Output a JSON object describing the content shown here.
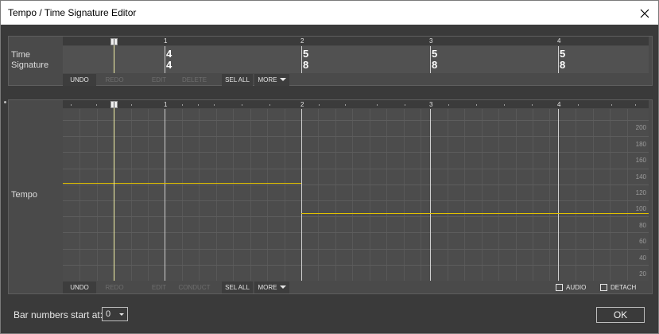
{
  "window": {
    "title": "Tempo / Time Signature Editor",
    "close_icon": "close-icon"
  },
  "time_signature_panel": {
    "label_line1": "Time",
    "label_line2": "Signature",
    "bar_numbers": [
      "1",
      "2",
      "3",
      "4"
    ],
    "signatures": [
      {
        "bar": "1",
        "numerator": "4",
        "denominator": "4"
      },
      {
        "bar": "2",
        "numerator": "5",
        "denominator": "8"
      },
      {
        "bar": "3",
        "numerator": "5",
        "denominator": "8"
      },
      {
        "bar": "4",
        "numerator": "5",
        "denominator": "8"
      }
    ],
    "toolbar": {
      "undo": "UNDO",
      "redo": "REDO",
      "edit": "EDIT",
      "delete": "DELETE",
      "sel_all": "SEL ALL",
      "more": "MORE"
    }
  },
  "tempo_panel": {
    "label": "Tempo",
    "bar_numbers": [
      "1",
      "2",
      "3",
      "4"
    ],
    "y_axis_labels": [
      "200",
      "180",
      "160",
      "140",
      "120",
      "100",
      "80",
      "60",
      "40",
      "20"
    ],
    "tempo_segments": [
      {
        "from_bar": "start",
        "to_bar": "2",
        "bpm": 122
      },
      {
        "from_bar": "2",
        "to_bar": "end",
        "bpm": 84
      }
    ],
    "toolbar": {
      "undo": "UNDO",
      "redo": "REDO",
      "edit": "EDIT",
      "conduct": "CONDUCT",
      "sel_all": "SEL ALL",
      "more": "MORE",
      "audio": "AUDIO",
      "detach": "DETACH"
    },
    "audio_checked": false,
    "detach_checked": false
  },
  "footer": {
    "bar_numbers_start_label": "Bar numbers start at:",
    "bar_numbers_start_value": "0",
    "ok_label": "OK"
  },
  "colors": {
    "tempo_line": "#e0c000",
    "playhead": "#f4f2a8",
    "panel_bg": "#4a4a4a",
    "window_bg": "#3a3a3a"
  }
}
